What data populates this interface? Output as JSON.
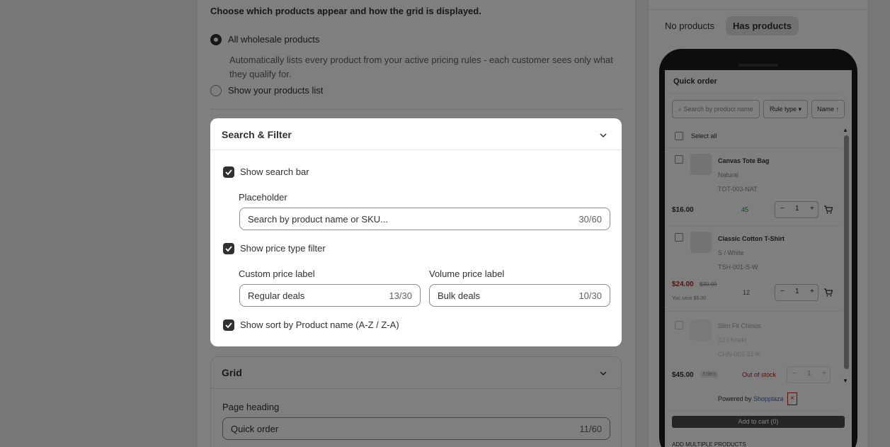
{
  "settings": {
    "description": "Choose which products appear and how the grid is displayed.",
    "options": [
      {
        "label": "All wholesale products",
        "description": "Automatically lists every product from your active pricing rules - each customer sees only what they qualify for.",
        "selected": true
      },
      {
        "label": "Show your products list",
        "selected": false
      }
    ]
  },
  "search_filter": {
    "title": "Search & Filter",
    "show_search_bar": {
      "label": "Show search bar",
      "checked": true
    },
    "placeholder_label": "Placeholder",
    "placeholder_value": "Search by product name or SKU...",
    "placeholder_count": "30/60",
    "show_price_type_filter": {
      "label": "Show price type filter",
      "checked": true
    },
    "custom_price_label": "Custom price label",
    "custom_price_value": "Regular deals",
    "custom_price_count": "13/30",
    "volume_price_label": "Volume price label",
    "volume_price_value": "Bulk deals",
    "volume_price_count": "10/30",
    "show_sort": {
      "label": "Show sort by Product name (A-Z / Z-A)",
      "checked": true
    }
  },
  "grid": {
    "title": "Grid",
    "page_heading_label": "Page heading",
    "page_heading_value": "Quick order",
    "page_heading_count": "11/60"
  },
  "preview": {
    "tabs": [
      "No products",
      "Has products"
    ],
    "active_tab": "Has products",
    "title": "Quick order",
    "search_placeholder": "Search by product name",
    "rule_type": "Rule type",
    "sort": "Name ↑",
    "select_all": "Select all",
    "products": [
      {
        "name": "Canvas Tote Bag",
        "variant": "Natural",
        "sku": "TOT-003-NAT",
        "price": "$16.00",
        "stock": "45",
        "qty": "1"
      },
      {
        "name": "Classic Cotton T-Shirt",
        "variant": "S / White",
        "sku": "TSH-001-S-W",
        "price": "$24.00",
        "compare_price": "$30.00",
        "savings": "You save $6.00",
        "stock": "12",
        "qty": "1"
      },
      {
        "name": "Slim Fit Chinos",
        "variant": "32 / Khaki",
        "sku": "CHN-002-32-K",
        "price": "$45.00",
        "tiers": "3 tiers",
        "status": "Out of stock",
        "qty": "1"
      }
    ],
    "powered_by": "Powered by",
    "brand": "Shopplaza",
    "add_to_cart": "Add to cart (0)",
    "add_multiple": "ADD MULTIPLE PRODUCTS"
  },
  "colors": {
    "accent": "#303030",
    "sale": "#b42318",
    "stock": "#2e7d32",
    "link": "#2c6ecb"
  }
}
